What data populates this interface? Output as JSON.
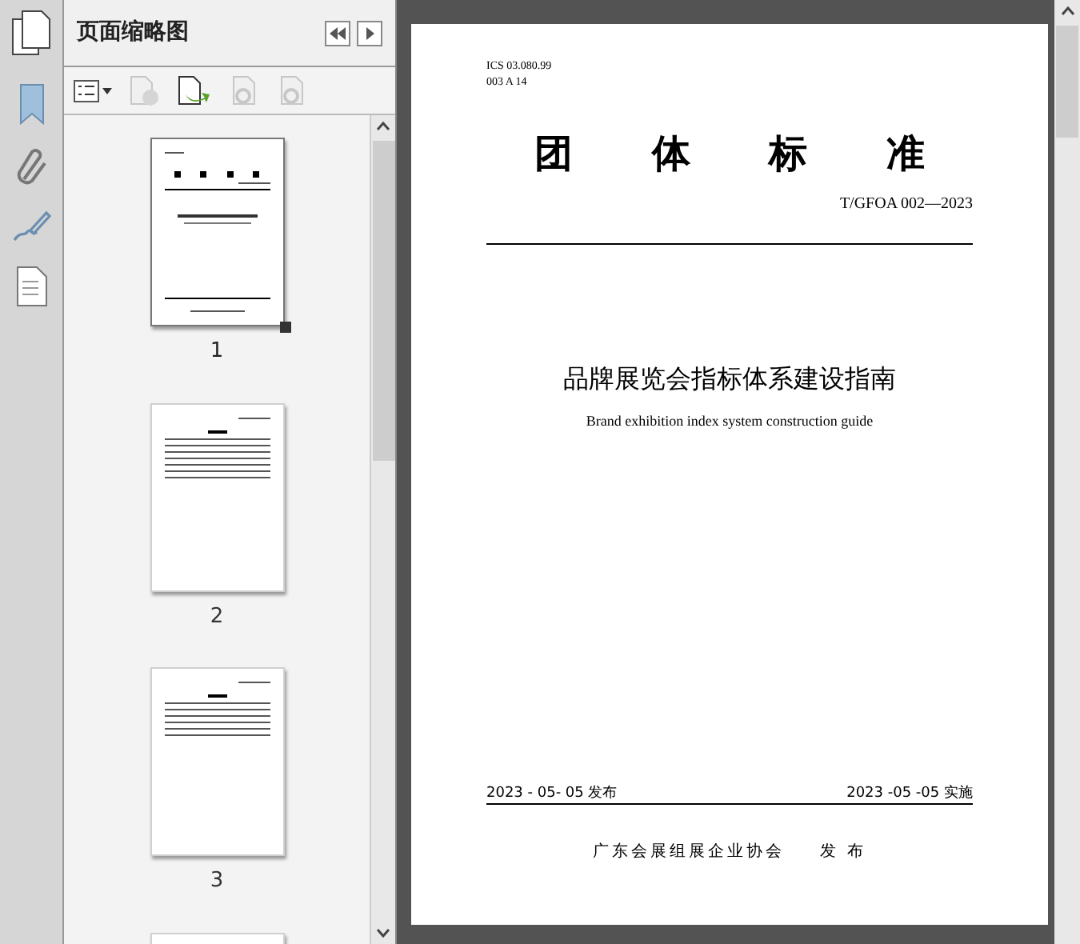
{
  "panel": {
    "title": "页面缩略图"
  },
  "thumbnails": [
    {
      "page": "1",
      "selected": true,
      "kind": "cover"
    },
    {
      "page": "2",
      "selected": false,
      "kind": "contents"
    },
    {
      "page": "3",
      "selected": false,
      "kind": "text"
    },
    {
      "selected": false,
      "kind": "text"
    }
  ],
  "document": {
    "codes": [
      "ICS 03.080.99",
      "003 A 14"
    ],
    "heading_chars": [
      "团",
      "体",
      "标",
      "准"
    ],
    "number": "T/GFOA 002—2023",
    "title": "品牌展览会指标体系建设指南",
    "subtitle": "Brand exhibition index system construction guide",
    "issued": "2023 - 05- 05 发布",
    "effective": "2023 -05 -05 实施",
    "publisher": "广东会展组展企业协会",
    "publisher_action": "发 布"
  }
}
